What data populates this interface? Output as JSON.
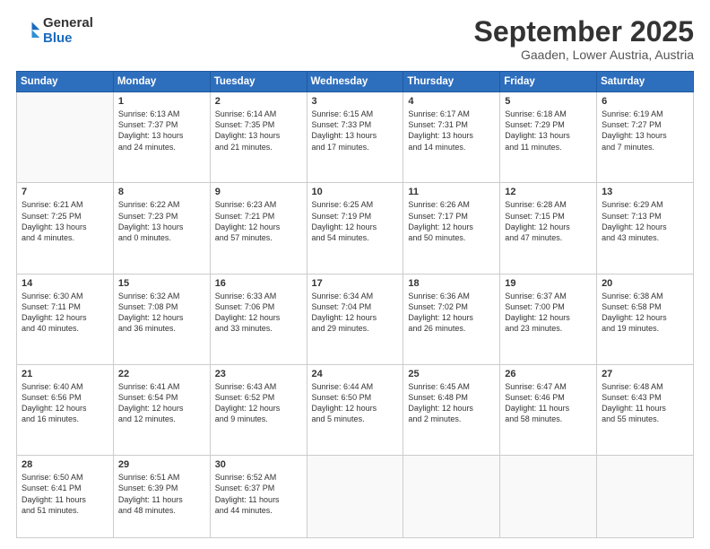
{
  "logo": {
    "general": "General",
    "blue": "Blue"
  },
  "header": {
    "month": "September 2025",
    "location": "Gaaden, Lower Austria, Austria"
  },
  "weekdays": [
    "Sunday",
    "Monday",
    "Tuesday",
    "Wednesday",
    "Thursday",
    "Friday",
    "Saturday"
  ],
  "weeks": [
    [
      {
        "day": "",
        "text": ""
      },
      {
        "day": "1",
        "text": "Sunrise: 6:13 AM\nSunset: 7:37 PM\nDaylight: 13 hours\nand 24 minutes."
      },
      {
        "day": "2",
        "text": "Sunrise: 6:14 AM\nSunset: 7:35 PM\nDaylight: 13 hours\nand 21 minutes."
      },
      {
        "day": "3",
        "text": "Sunrise: 6:15 AM\nSunset: 7:33 PM\nDaylight: 13 hours\nand 17 minutes."
      },
      {
        "day": "4",
        "text": "Sunrise: 6:17 AM\nSunset: 7:31 PM\nDaylight: 13 hours\nand 14 minutes."
      },
      {
        "day": "5",
        "text": "Sunrise: 6:18 AM\nSunset: 7:29 PM\nDaylight: 13 hours\nand 11 minutes."
      },
      {
        "day": "6",
        "text": "Sunrise: 6:19 AM\nSunset: 7:27 PM\nDaylight: 13 hours\nand 7 minutes."
      }
    ],
    [
      {
        "day": "7",
        "text": "Sunrise: 6:21 AM\nSunset: 7:25 PM\nDaylight: 13 hours\nand 4 minutes."
      },
      {
        "day": "8",
        "text": "Sunrise: 6:22 AM\nSunset: 7:23 PM\nDaylight: 13 hours\nand 0 minutes."
      },
      {
        "day": "9",
        "text": "Sunrise: 6:23 AM\nSunset: 7:21 PM\nDaylight: 12 hours\nand 57 minutes."
      },
      {
        "day": "10",
        "text": "Sunrise: 6:25 AM\nSunset: 7:19 PM\nDaylight: 12 hours\nand 54 minutes."
      },
      {
        "day": "11",
        "text": "Sunrise: 6:26 AM\nSunset: 7:17 PM\nDaylight: 12 hours\nand 50 minutes."
      },
      {
        "day": "12",
        "text": "Sunrise: 6:28 AM\nSunset: 7:15 PM\nDaylight: 12 hours\nand 47 minutes."
      },
      {
        "day": "13",
        "text": "Sunrise: 6:29 AM\nSunset: 7:13 PM\nDaylight: 12 hours\nand 43 minutes."
      }
    ],
    [
      {
        "day": "14",
        "text": "Sunrise: 6:30 AM\nSunset: 7:11 PM\nDaylight: 12 hours\nand 40 minutes."
      },
      {
        "day": "15",
        "text": "Sunrise: 6:32 AM\nSunset: 7:08 PM\nDaylight: 12 hours\nand 36 minutes."
      },
      {
        "day": "16",
        "text": "Sunrise: 6:33 AM\nSunset: 7:06 PM\nDaylight: 12 hours\nand 33 minutes."
      },
      {
        "day": "17",
        "text": "Sunrise: 6:34 AM\nSunset: 7:04 PM\nDaylight: 12 hours\nand 29 minutes."
      },
      {
        "day": "18",
        "text": "Sunrise: 6:36 AM\nSunset: 7:02 PM\nDaylight: 12 hours\nand 26 minutes."
      },
      {
        "day": "19",
        "text": "Sunrise: 6:37 AM\nSunset: 7:00 PM\nDaylight: 12 hours\nand 23 minutes."
      },
      {
        "day": "20",
        "text": "Sunrise: 6:38 AM\nSunset: 6:58 PM\nDaylight: 12 hours\nand 19 minutes."
      }
    ],
    [
      {
        "day": "21",
        "text": "Sunrise: 6:40 AM\nSunset: 6:56 PM\nDaylight: 12 hours\nand 16 minutes."
      },
      {
        "day": "22",
        "text": "Sunrise: 6:41 AM\nSunset: 6:54 PM\nDaylight: 12 hours\nand 12 minutes."
      },
      {
        "day": "23",
        "text": "Sunrise: 6:43 AM\nSunset: 6:52 PM\nDaylight: 12 hours\nand 9 minutes."
      },
      {
        "day": "24",
        "text": "Sunrise: 6:44 AM\nSunset: 6:50 PM\nDaylight: 12 hours\nand 5 minutes."
      },
      {
        "day": "25",
        "text": "Sunrise: 6:45 AM\nSunset: 6:48 PM\nDaylight: 12 hours\nand 2 minutes."
      },
      {
        "day": "26",
        "text": "Sunrise: 6:47 AM\nSunset: 6:46 PM\nDaylight: 11 hours\nand 58 minutes."
      },
      {
        "day": "27",
        "text": "Sunrise: 6:48 AM\nSunset: 6:43 PM\nDaylight: 11 hours\nand 55 minutes."
      }
    ],
    [
      {
        "day": "28",
        "text": "Sunrise: 6:50 AM\nSunset: 6:41 PM\nDaylight: 11 hours\nand 51 minutes."
      },
      {
        "day": "29",
        "text": "Sunrise: 6:51 AM\nSunset: 6:39 PM\nDaylight: 11 hours\nand 48 minutes."
      },
      {
        "day": "30",
        "text": "Sunrise: 6:52 AM\nSunset: 6:37 PM\nDaylight: 11 hours\nand 44 minutes."
      },
      {
        "day": "",
        "text": ""
      },
      {
        "day": "",
        "text": ""
      },
      {
        "day": "",
        "text": ""
      },
      {
        "day": "",
        "text": ""
      }
    ]
  ]
}
